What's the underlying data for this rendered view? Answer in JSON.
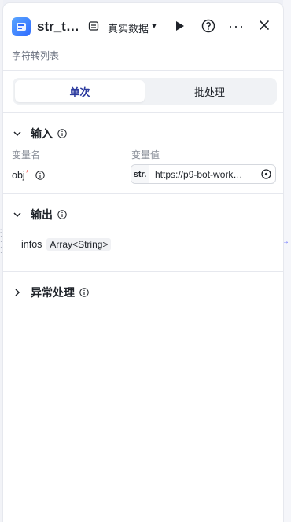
{
  "header": {
    "title": "str_t…",
    "data_mode_label": "真实数据",
    "subtitle": "字符转列表"
  },
  "tabs": [
    {
      "label": "单次",
      "active": true
    },
    {
      "label": "批处理",
      "active": false
    }
  ],
  "input_section": {
    "title": "输入",
    "column_name_label": "变量名",
    "column_value_label": "变量值",
    "params": [
      {
        "name": "obj",
        "required_mark": "*",
        "type_tag": "str.",
        "value": "https://p9-bot-work…"
      }
    ]
  },
  "output_section": {
    "title": "输出",
    "fields": [
      {
        "name": "infos",
        "type": "Array<String>"
      }
    ]
  },
  "exception_section": {
    "title": "异常处理"
  },
  "colors": {
    "accent": "#2b3a9e",
    "required": "#f54a45"
  },
  "icons": [
    "app-icon",
    "data-source-icon",
    "chevron-down-icon",
    "play-icon",
    "help-icon",
    "more-icon",
    "close-icon",
    "info-icon",
    "chevron-right-icon",
    "target-icon"
  ]
}
